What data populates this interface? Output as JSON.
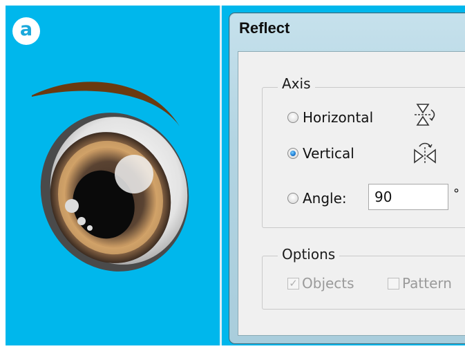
{
  "illustration": {
    "step_badge": "a",
    "background_color": "#00b7ec",
    "iris_color": "#c99a63",
    "eyebrow_color": "#6b3a10"
  },
  "dialog": {
    "title": "Reflect",
    "axis_group": {
      "label": "Axis",
      "options": [
        {
          "label": "Horizontal",
          "selected": false,
          "icon": "reflect-horizontal-icon"
        },
        {
          "label": "Vertical",
          "selected": true,
          "icon": "reflect-vertical-icon"
        },
        {
          "label": "Angle:",
          "selected": false
        }
      ],
      "angle_value": "90",
      "angle_unit": "°"
    },
    "options_group": {
      "label": "Options",
      "objects_label": "Objects",
      "objects_checked": true,
      "objects_enabled": false,
      "patterns_label": "Pattern",
      "patterns_checked": false,
      "patterns_enabled": false
    }
  }
}
